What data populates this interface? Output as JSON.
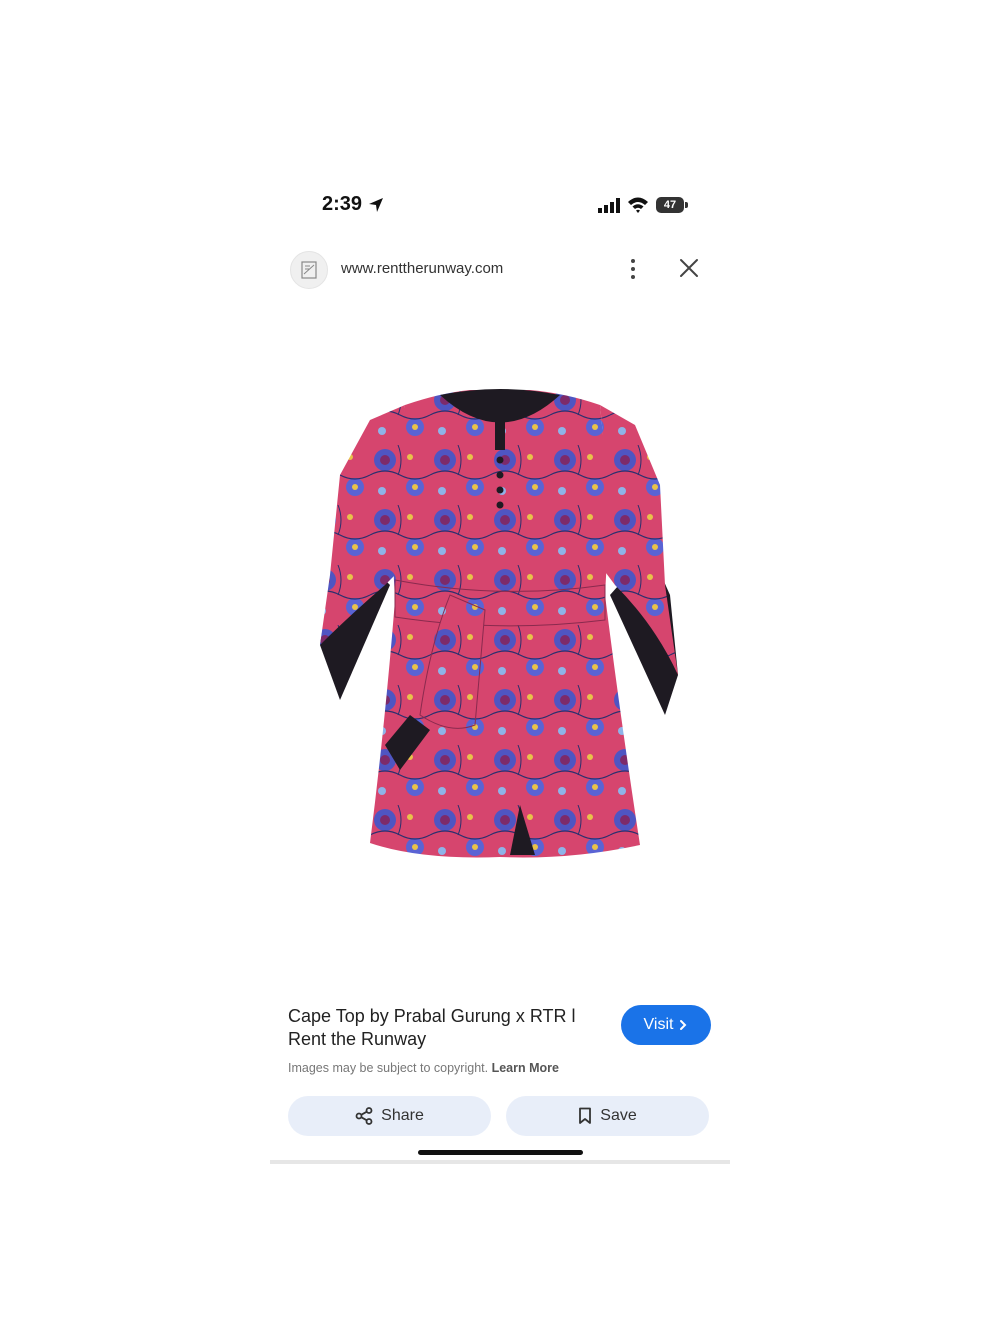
{
  "status_bar": {
    "time": "2:39",
    "battery": "47",
    "icons": [
      "location-arrow-icon",
      "cellular-signal-icon",
      "wifi-icon",
      "battery-icon"
    ]
  },
  "url_bar": {
    "url": "www.renttherunway.com",
    "icons": [
      "site-favicon-icon",
      "more-vertical-icon",
      "close-icon"
    ]
  },
  "product": {
    "image_description_icon": "dress-image",
    "title": "Cape Top by Prabal Gurung x RTR l Rent the Runway",
    "colors": {
      "fabric": "#d6456e",
      "flower": "#4f55c2",
      "lining": "#1e1a22"
    }
  },
  "actions": {
    "visit_label": "Visit",
    "share_label": "Share",
    "save_label": "Save",
    "accent": "#1a73e8",
    "pill_bg": "#e8eef9"
  },
  "copyright": {
    "text": "Images may be subject to copyright.",
    "learn_more": "Learn More"
  }
}
